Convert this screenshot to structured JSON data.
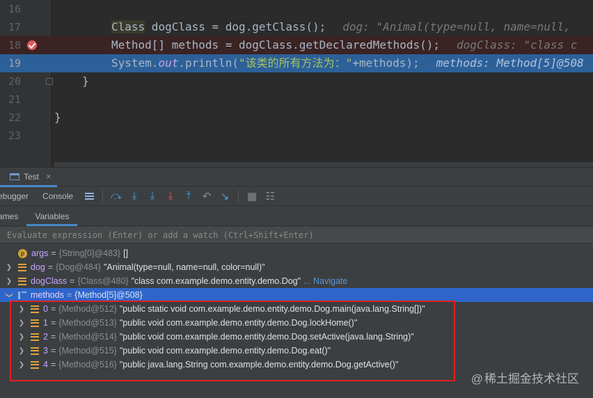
{
  "editor": {
    "lines": [
      {
        "num": "16",
        "code": ""
      },
      {
        "num": "17",
        "code": "Class dogClass = dog.getClass();",
        "hint": "dog: \"Animal(type=null, name=null,"
      },
      {
        "num": "18",
        "code": "Method[] methods = dogClass.getDeclaredMethods();",
        "hint": "dogClass: \"class c"
      },
      {
        "num": "19",
        "code_pre": "System.",
        "code_field": "out",
        "code_mid": ".println(",
        "code_str": "\"该类的所有方法为：\"",
        "code_post": "+methods);",
        "hint": "methods: Method[5]@508"
      },
      {
        "num": "20",
        "code": "}"
      },
      {
        "num": "21",
        "code": ""
      },
      {
        "num": "22",
        "code": "}"
      },
      {
        "num": "23",
        "code": ""
      }
    ],
    "class_keyword": "Class"
  },
  "debug_panel": {
    "run_tab_label": "Test",
    "close_glyph": "×",
    "toolbar_tabs": [
      "ebugger",
      "Console"
    ],
    "subtabs": [
      "ames",
      "Variables"
    ],
    "eval_placeholder": "Evaluate expression (Enter) or add a watch (Ctrl+Shift+Enter)"
  },
  "variables": [
    {
      "name": "args",
      "type": "{String[0]@483}",
      "value": "[]",
      "icon": "parameter-icon"
    },
    {
      "name": "dog",
      "type": "{Dog@484}",
      "value": "\"Animal(type=null, name=null, color=null)\"",
      "icon": "field-icon"
    },
    {
      "name": "dogClass",
      "type": "{Class@480}",
      "value": "\"class com.example.demo.entity.demo.Dog\"",
      "link": "... Navigate",
      "icon": "field-icon"
    },
    {
      "name": "methods",
      "type": "{Method[5]@508}",
      "value": "",
      "icon": "array-icon"
    }
  ],
  "methods": [
    {
      "index": "0",
      "type": "{Method@512}",
      "value": "\"public static void com.example.demo.entity.demo.Dog.main(java.lang.String[])\""
    },
    {
      "index": "1",
      "type": "{Method@513}",
      "value": "\"public void com.example.demo.entity.demo.Dog.lockHome()\""
    },
    {
      "index": "2",
      "type": "{Method@514}",
      "value": "\"public void com.example.demo.entity.demo.Dog.setActive(java.lang.String)\""
    },
    {
      "index": "3",
      "type": "{Method@515}",
      "value": "\"public void com.example.demo.entity.demo.Dog.eat()\""
    },
    {
      "index": "4",
      "type": "{Method@516}",
      "value": "\"public java.lang.String com.example.demo.entity.demo.Dog.getActive()\""
    }
  ],
  "watermark": {
    "at": "@",
    "text": "稀土掘金技术社区"
  },
  "colors": {
    "selection": "#2f65ca",
    "exec_line": "#2d6099",
    "breakpoint": "#db5c5c",
    "highlight_box": "#e0201f"
  }
}
